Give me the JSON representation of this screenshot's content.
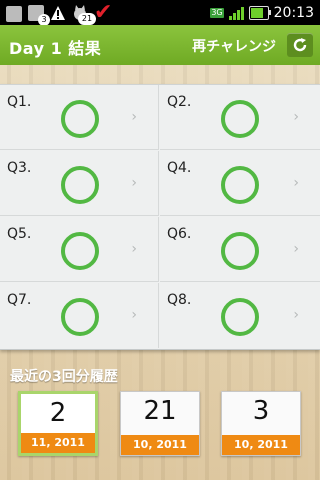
{
  "status_bar": {
    "badge_count_1": "3",
    "badge_count_2": "21",
    "network": "3G",
    "time": "20:13",
    "battery_level": 0.8,
    "icons": [
      "bag-icon",
      "bag-icon",
      "warning-icon",
      "cat-notification-icon",
      "checkmark-icon",
      "network-3g-icon",
      "signal-icon",
      "battery-icon"
    ]
  },
  "header": {
    "title": "Day 1 結果",
    "retry_label": "再チャレンジ",
    "retry_icon": "refresh-icon"
  },
  "questions": [
    {
      "label": "Q1.",
      "result": "correct"
    },
    {
      "label": "Q2.",
      "result": "correct"
    },
    {
      "label": "Q3.",
      "result": "correct"
    },
    {
      "label": "Q4.",
      "result": "correct"
    },
    {
      "label": "Q5.",
      "result": "correct"
    },
    {
      "label": "Q6.",
      "result": "correct"
    },
    {
      "label": "Q7.",
      "result": "correct"
    },
    {
      "label": "Q8.",
      "result": "correct"
    }
  ],
  "history": {
    "title": "最近の3回分履歴",
    "cards": [
      {
        "number": "2",
        "date": "11, 2011",
        "selected": true
      },
      {
        "number": "21",
        "date": "10, 2011",
        "selected": false
      },
      {
        "number": "3",
        "date": "10, 2011",
        "selected": false
      }
    ]
  },
  "colors": {
    "header_green": "#7bb832",
    "ring_green": "#52b843",
    "date_orange": "#ef8a13",
    "selected_border": "#a9d56b"
  }
}
